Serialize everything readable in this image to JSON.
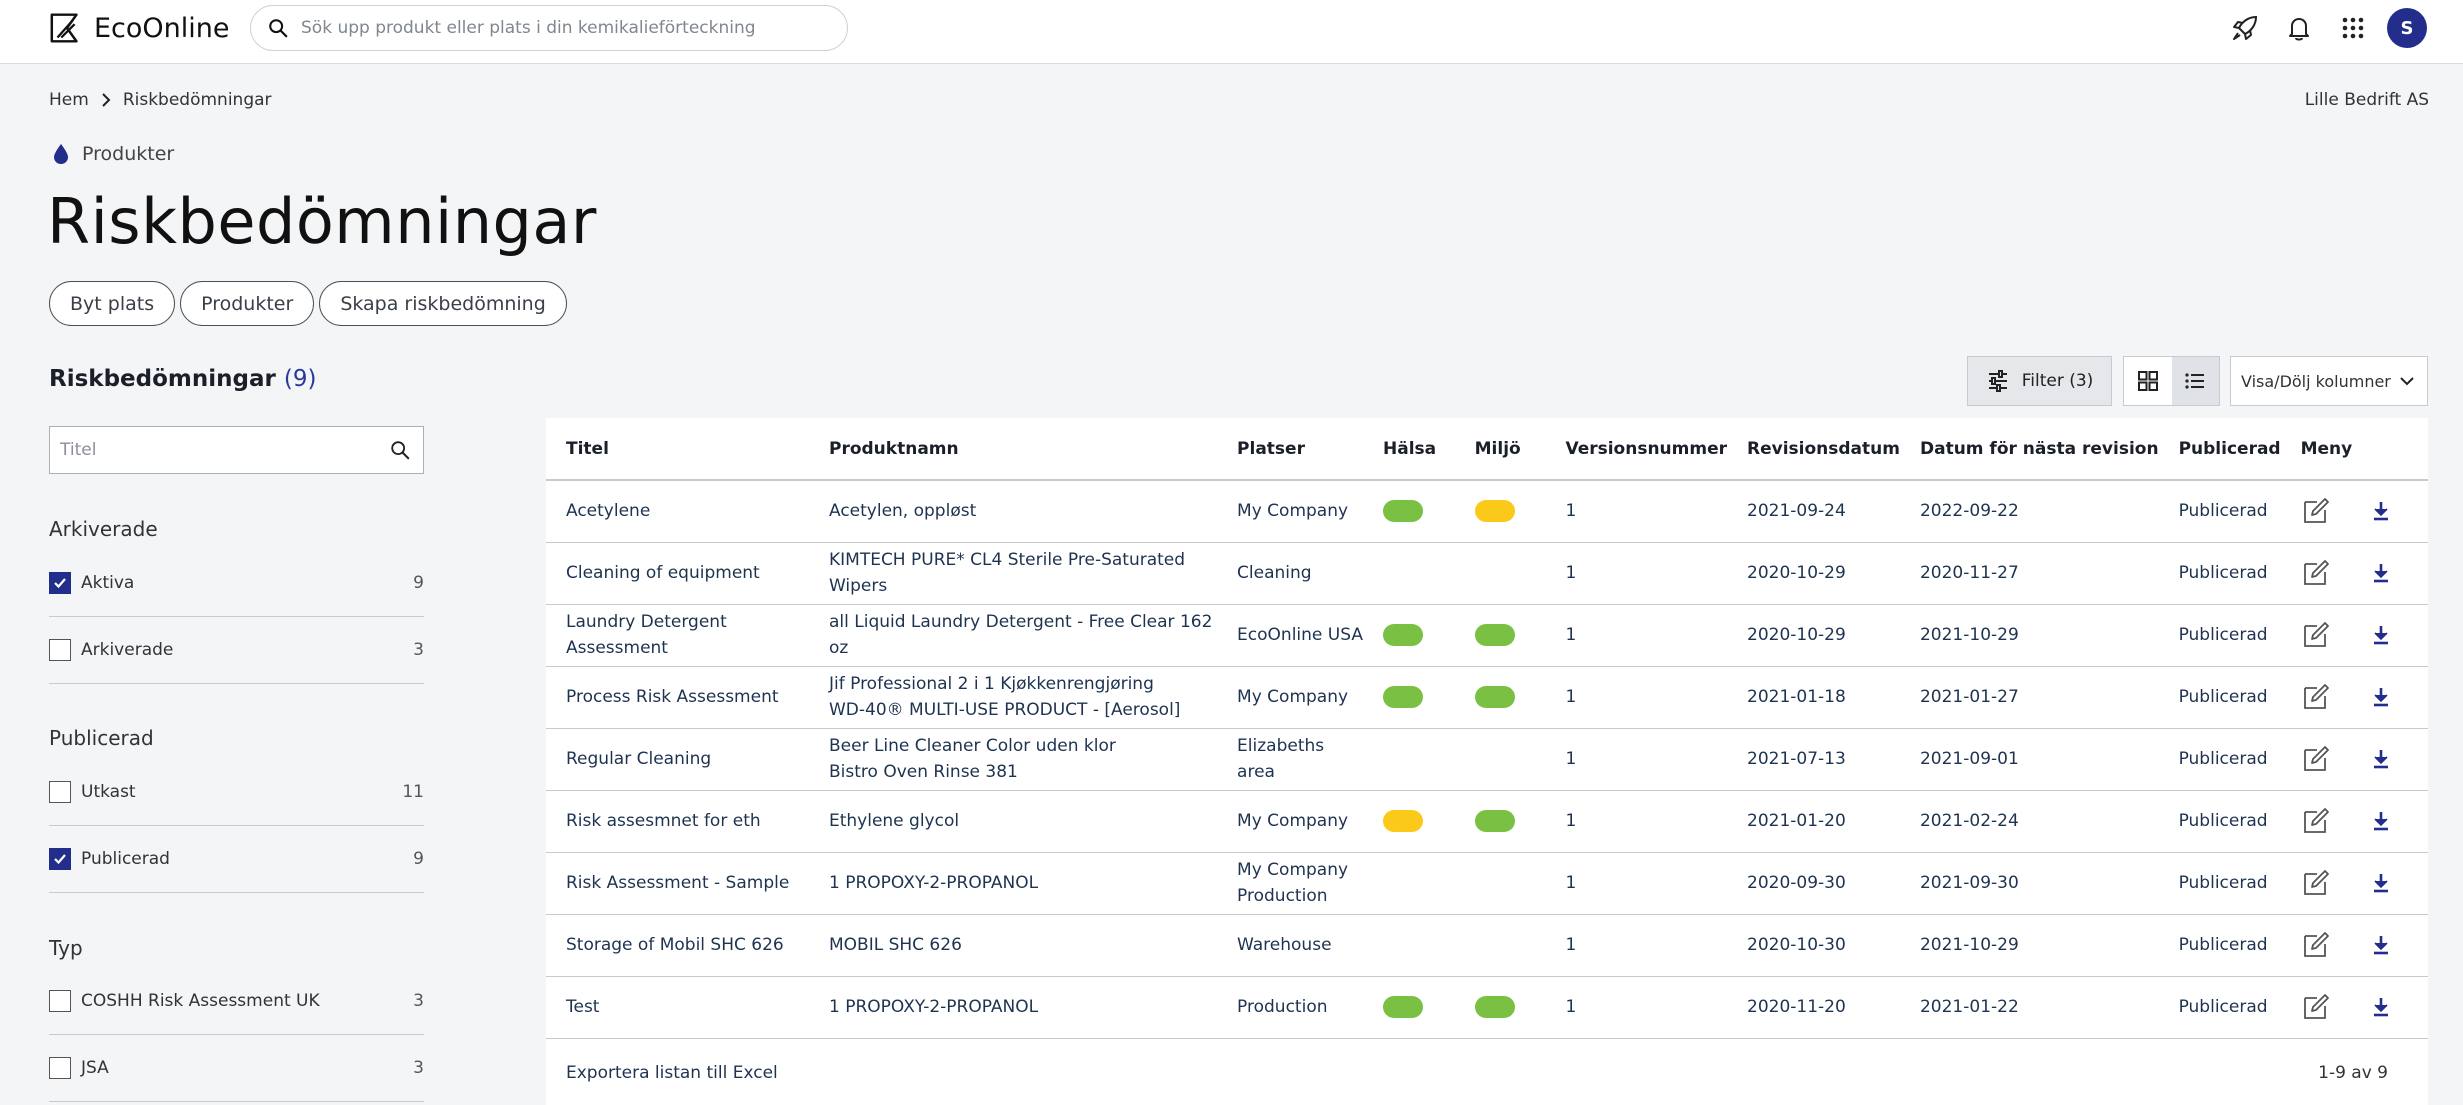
{
  "colors": {
    "accent": "#232d8c",
    "green": "#7ac143",
    "yellow": "#fbc91a"
  },
  "header": {
    "brand": "EcoOnline",
    "search_placeholder": "Sök upp produkt eller plats i din kemikalieförteckning",
    "icons": [
      "rocket-icon",
      "bell-icon",
      "apps-grid-icon"
    ],
    "avatar": "S"
  },
  "breadcrumb": {
    "home": "Hem",
    "current": "Riskbedömningar"
  },
  "company": "Lille Bedrift AS",
  "section_tag": "Produkter",
  "page_title": "Riskbedömningar",
  "actions": {
    "change_location": "Byt plats",
    "products": "Produkter",
    "create": "Skapa riskbedömning"
  },
  "list": {
    "title": "Riskbedömningar",
    "count": "(9)"
  },
  "toolbar": {
    "filter_label": "Filter (3)",
    "columns_label": "Visa/Dölj kolumner"
  },
  "sidebar": {
    "search_placeholder": "Titel",
    "groups": [
      {
        "title": "Arkiverade",
        "items": [
          {
            "label": "Aktiva",
            "count": "9",
            "checked": true
          },
          {
            "label": "Arkiverade",
            "count": "3",
            "checked": false
          }
        ]
      },
      {
        "title": "Publicerad",
        "items": [
          {
            "label": "Utkast",
            "count": "11",
            "checked": false
          },
          {
            "label": "Publicerad",
            "count": "9",
            "checked": true
          }
        ]
      },
      {
        "title": "Typ",
        "items": [
          {
            "label": "COSHH Risk Assessment UK",
            "count": "3",
            "checked": false
          },
          {
            "label": "JSA",
            "count": "3",
            "checked": false
          }
        ]
      }
    ]
  },
  "table": {
    "columns": [
      "Titel",
      "Produktnamn",
      "Platser",
      "Hälsa",
      "Miljö",
      "Versionsnummer",
      "Revisionsdatum",
      "Datum för nästa revision",
      "Publicerad",
      "Meny"
    ],
    "rows": [
      {
        "title": "Acetylene",
        "product": [
          "Acetylen, oppløst"
        ],
        "places": [
          "My Company"
        ],
        "health": "yellow-green",
        "env": "yellow",
        "version": "1",
        "rev": "2021-09-24",
        "next": "2022-09-22",
        "pub": "Publicerad"
      },
      {
        "title": "Cleaning of equipment",
        "product": [
          "KIMTECH PURE* CL4 Sterile Pre-Saturated Wipers"
        ],
        "places": [
          "Cleaning"
        ],
        "health": "",
        "env": "",
        "version": "1",
        "rev": "2020-10-29",
        "next": "2020-11-27",
        "pub": "Publicerad"
      },
      {
        "title": "Laundry Detergent Assessment",
        "product": [
          "all Liquid Laundry Detergent - Free Clear 162 oz"
        ],
        "places": [
          "EcoOnline USA"
        ],
        "health": "green",
        "env": "green",
        "version": "1",
        "rev": "2020-10-29",
        "next": "2021-10-29",
        "pub": "Publicerad"
      },
      {
        "title": "Process Risk Assessment",
        "product": [
          "Jif Professional 2 i 1 Kjøkkenrengjøring",
          "WD-40® MULTI-USE PRODUCT - [Aerosol]"
        ],
        "places": [
          "My Company"
        ],
        "health": "green",
        "env": "green",
        "version": "1",
        "rev": "2021-01-18",
        "next": "2021-01-27",
        "pub": "Publicerad"
      },
      {
        "title": "Regular Cleaning",
        "product": [
          "Beer Line Cleaner Color uden klor",
          "Bistro Oven Rinse 381"
        ],
        "places": [
          "Elizabeths area"
        ],
        "health": "",
        "env": "",
        "version": "1",
        "rev": "2021-07-13",
        "next": "2021-09-01",
        "pub": "Publicerad"
      },
      {
        "title": "Risk assesmnet for eth",
        "product": [
          "Ethylene glycol"
        ],
        "places": [
          "My Company"
        ],
        "health": "yellow",
        "env": "green",
        "version": "1",
        "rev": "2021-01-20",
        "next": "2021-02-24",
        "pub": "Publicerad"
      },
      {
        "title": "Risk Assessment - Sample",
        "product": [
          "1 PROPOXY-2-PROPANOL"
        ],
        "places": [
          "My Company",
          "Production"
        ],
        "health": "",
        "env": "",
        "version": "1",
        "rev": "2020-09-30",
        "next": "2021-09-30",
        "pub": "Publicerad"
      },
      {
        "title": "Storage of Mobil SHC 626",
        "product": [
          "MOBIL SHC 626"
        ],
        "places": [
          "Warehouse"
        ],
        "health": "",
        "env": "",
        "version": "1",
        "rev": "2020-10-30",
        "next": "2021-10-29",
        "pub": "Publicerad"
      },
      {
        "title": "Test",
        "product": [
          "1 PROPOXY-2-PROPANOL"
        ],
        "places": [
          "Production"
        ],
        "health": "green",
        "env": "green",
        "version": "1",
        "rev": "2020-11-20",
        "next": "2021-01-22",
        "pub": "Publicerad"
      }
    ],
    "export_label": "Exportera listan till Excel",
    "pagination": "1-9 av 9"
  }
}
